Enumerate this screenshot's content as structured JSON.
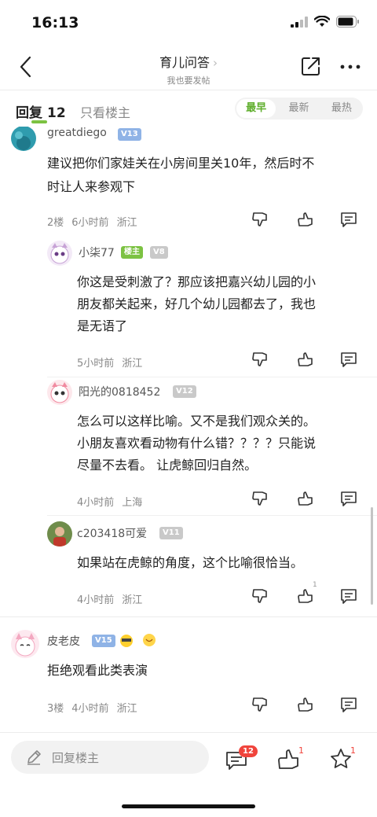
{
  "status": {
    "time": "16:13"
  },
  "nav": {
    "title": "育儿问答",
    "subtitle": "我也要发帖"
  },
  "tabs": {
    "reply_label": "回复",
    "reply_count": "12",
    "owner_only": "只看楼主"
  },
  "sort": {
    "options": [
      "最早",
      "最新",
      "最热"
    ],
    "active": "最早"
  },
  "comments": {
    "c1": {
      "user": "greatdiego",
      "level": "V13",
      "text_l1": "建议把你们家娃关在小房间里关10年，然后时不",
      "text_l2": "时让人来参观下",
      "floor": "2楼",
      "time": "6小时前",
      "loc": "浙江"
    },
    "r1": {
      "user": "小柒77",
      "owner_badge": "楼主",
      "level": "V8",
      "text_l1": "你这是受刺激了？那应该把嘉兴幼儿园的小",
      "text_l2": "朋友都关起来，好几个幼儿园都去了，我也",
      "text_l3": "是无语了",
      "time": "5小时前",
      "loc": "浙江"
    },
    "r2": {
      "user": "阳光的0818452",
      "level": "V12",
      "text_l1": "怎么可以这样比喻。又不是我们观众关的。",
      "text_l2": "小朋友喜欢看动物有什么错？？？？只能说",
      "text_l3": "尽量不去看。 让虎鲸回归自然。",
      "time": "4小时前",
      "loc": "上海"
    },
    "r3": {
      "user": "c203418可爱",
      "level": "V11",
      "text_l1": "如果站在虎鲸的角度，这个比喻很恰当。",
      "time": "4小时前",
      "loc": "浙江",
      "like_count": "1"
    },
    "c2": {
      "user": "皮老皮",
      "level": "V15",
      "text_l1": "拒绝观看此类表演",
      "floor": "3楼",
      "time": "4小时前",
      "loc": "浙江"
    }
  },
  "bottom": {
    "reply_placeholder": "回复楼主",
    "comment_count": "12",
    "like_count": "1",
    "fav_count": "1"
  },
  "colors": {
    "accent_green": "#7cc242",
    "badge_red": "#f0443c",
    "vip_blue": "#8fb3e6"
  }
}
